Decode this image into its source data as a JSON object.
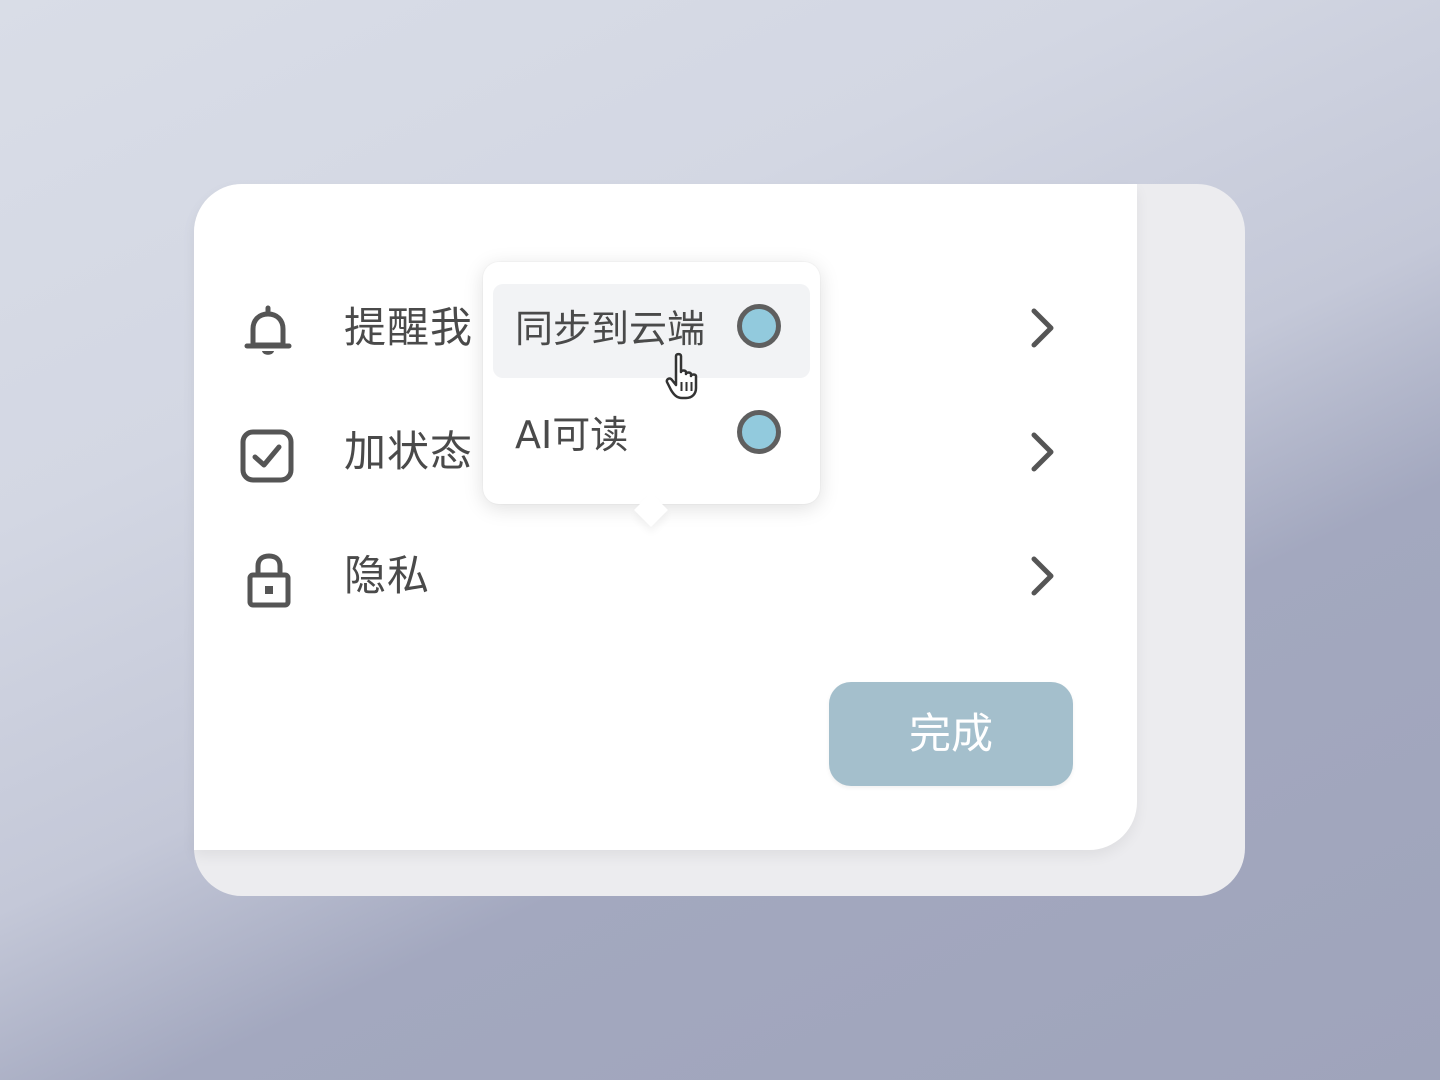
{
  "menu": {
    "items": [
      {
        "label": "提醒我",
        "icon": "bell-icon"
      },
      {
        "label": "加状态",
        "icon": "checkbox-icon"
      },
      {
        "label": "隐私",
        "icon": "lock-icon"
      }
    ]
  },
  "popover": {
    "options": [
      {
        "label": "同步到云端",
        "selected": true
      },
      {
        "label": "AI可读",
        "selected": true
      }
    ]
  },
  "done_button": {
    "label": "完成"
  },
  "colors": {
    "accent_radio": "#92cadd",
    "done_button": "#a4bfcc",
    "text": "#4a4a4a"
  }
}
